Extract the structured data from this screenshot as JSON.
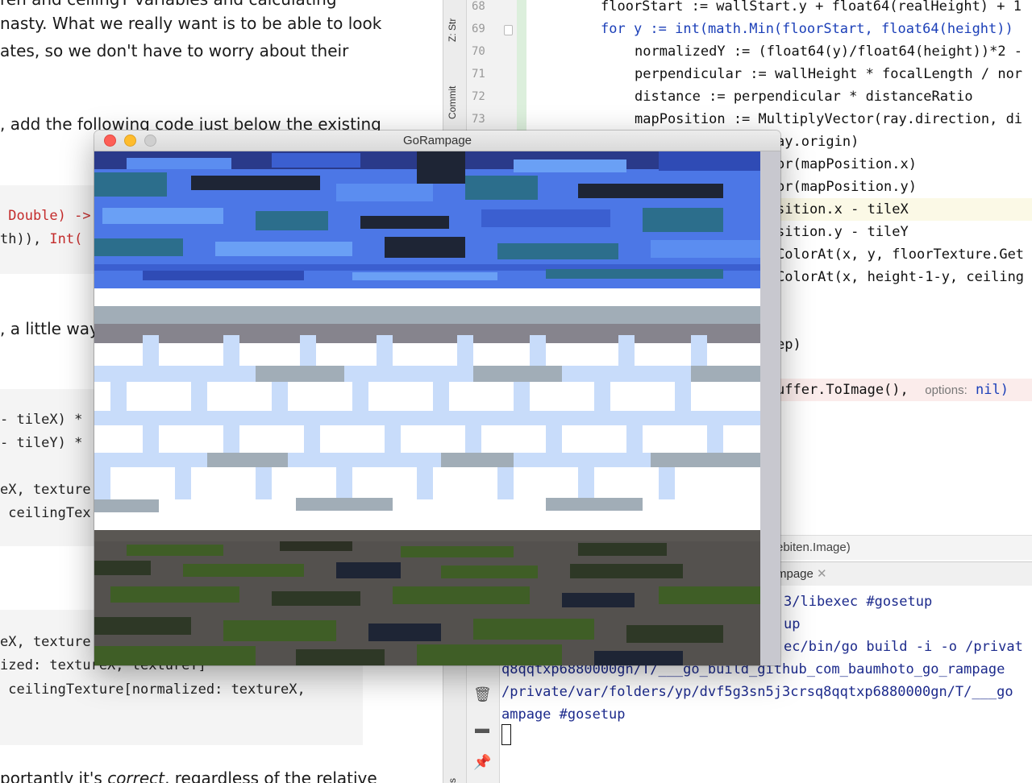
{
  "tutorial": {
    "p1_line0": "ren and ceilingY variables and calculating",
    "p1_line1": "nasty. What we really want is to be able to look",
    "p1_line2": "ates, so we don't have to worry about their",
    "p2_line0": ", add the following code just below the existing",
    "code1_line0_a": " Double) ->",
    "code1_line1_a": "th)), ",
    "code1_line1_b": "Int(",
    "p3_line0": ", a little way",
    "code2_line0": "- tileX) *",
    "code2_line1": "- tileY) *",
    "code2_line2": "eX, texture",
    "code2_line3": " ceilingTex",
    "code3_line0": "eX, texture",
    "code3_line1": "ized: textureX, textureY]",
    "code3_line2": " ceilingTexture[normalized: textureX,",
    "p4_prefix": "portantly it's ",
    "p4_italic": "correct",
    "p4_suffix": ", regardless of the relative"
  },
  "ide": {
    "side_tabs": [
      "Z: Str",
      "Commit",
      "s"
    ],
    "line_numbers": [
      "68",
      "69",
      "70",
      "71",
      "72",
      "73"
    ],
    "code_lines": [
      "floorStart := wallStart.y + float64(realHeight) + 1",
      "for y := int(math.Min(floorStart, float64(height))",
      "normalizedY := (float64(y)/float64(height))*2 -",
      "perpendicular := wallHeight * focalLength / nor",
      "distance := perpendicular * distanceRatio",
      "mapPosition := MultiplyVector(ray.direction, di",
      "ay.origin)",
      "or(mapPosition.x)",
      "or(mapPosition.y)",
      "sition.x - tileX",
      "sition.y - tileY",
      "ColorAt(x, y, floorTexture.Get",
      "ColorAt(x, height-1-y, ceiling",
      "ep)",
      "uffer.ToImage(),"
    ],
    "param_hint_label": "options:",
    "param_hint_value": "nil)",
    "breadcrumb_text": "ebiten.Image)",
    "run_tab_label": "mpage",
    "console_lines": [
      "3/libexec #gosetup",
      "up",
      "ec/bin/go build -i -o /privat",
      "q8qqtxp6880000gn/T/___go_build_github_com_baumhoto_go_rampage",
      "/private/var/folders/yp/dvf5g3sn5j3crsq8qqtxp6880000gn/T/___go",
      "ampage #gosetup"
    ]
  },
  "game_window": {
    "title": "GoRampage"
  },
  "colors": {
    "close": "#fd5f57",
    "minimize": "#febc2e",
    "zoom": "#cfcfcf",
    "ceiling_blue": "#4c77e6",
    "wall_light": "#c8dcfa",
    "floor_gray": "#54514e",
    "floor_green": "#3f5e26"
  }
}
